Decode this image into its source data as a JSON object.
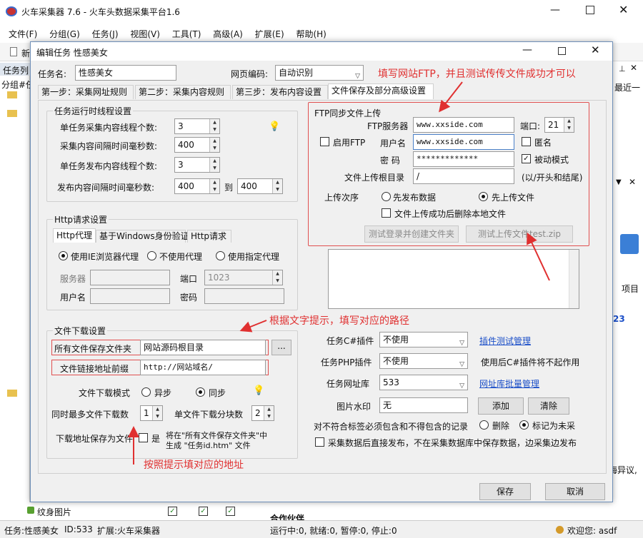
{
  "app": {
    "title": "火车采集器 7.6 - 火车头数据采集平台1.6",
    "menu": [
      "文件(F)",
      "分组(G)",
      "任务(J)",
      "视图(V)",
      "工具(T)",
      "高级(A)",
      "扩展(E)",
      "帮助(H)"
    ],
    "toolbar_new": "新",
    "left_panel_title": "任务列",
    "left_group_label": "分组#任",
    "right_partial_label": "最近一",
    "right_item_label": "项目",
    "right_num": "23",
    "right_text": "海异议,",
    "bottom_tree_label": "纹身图片",
    "bottom_right_text": "合作伙伴"
  },
  "dialog": {
    "title": "编辑任务 性感美女",
    "task_name_label": "任务名:",
    "task_name": "性感美女",
    "encoding_label": "网页编码:",
    "encoding": "自动识别",
    "tabs": [
      "第一步：采集网址规则",
      "第二步：采集内容规则",
      "第三步：发布内容设置",
      "文件保存及部分高级设置"
    ],
    "thread": {
      "title": "任务运行时线程设置",
      "rows": [
        {
          "label": "单任务采集内容线程个数:",
          "value": "3"
        },
        {
          "label": "采集内容间隔时间毫秒数:",
          "value": "400"
        },
        {
          "label": "单任务发布内容线程个数:",
          "value": "3"
        },
        {
          "label": "发布内容间隔时间毫秒数:",
          "value": "400",
          "to_label": "到",
          "to_value": "400"
        }
      ]
    },
    "http": {
      "title": "Http请求设置",
      "tabs": [
        "Http代理",
        "基于Windows身份验证",
        "Http请求"
      ],
      "radios": [
        "使用IE浏览器代理",
        "不使用代理",
        "使用指定代理"
      ],
      "server_label": "服务器",
      "port_label": "端口",
      "port": "1023",
      "user_label": "用户名",
      "pwd_label": "密码"
    },
    "ftp": {
      "title": "FTP同步文件上传",
      "server_label": "FTP服务器",
      "server": "www.xxside.com",
      "port_label": "端口:",
      "port": "21",
      "enable_label": "启用FTP",
      "user_label": "用户名",
      "user": "www.xxside.com",
      "anon_label": "匿名",
      "pwd_label": "密  码",
      "pwd": "*************",
      "passive_label": "被动模式",
      "root_label": "文件上传根目录",
      "root": "/",
      "root_hint": "(以/开头和结尾)",
      "order_label": "上传次序",
      "order_opt1": "先发布数据",
      "order_opt2": "先上传文件",
      "delete_label": "文件上传成功后删除本地文件",
      "btn_login": "测试登录并创建文件夹",
      "btn_upload": "测试上传文件test.zip"
    },
    "download": {
      "title": "文件下载设置",
      "folder_label": "所有文件保存文件夹",
      "folder": "网站源码根目录",
      "browse": "...",
      "prefix_label": "文件链接地址前缀",
      "prefix": "http://网站域名/",
      "mode_label": "文件下载模式",
      "mode_async": "异步",
      "mode_sync": "同步",
      "max_label": "同时最多文件下载数",
      "max": "1",
      "block_label": "单文件下载分块数",
      "block": "2",
      "saveas_label": "下载地址保存为文件",
      "saveas_yes": "是",
      "saveas_desc1": "将在\"所有文件保存文件夹\"中",
      "saveas_desc2": "生成 \"任务id.htm\" 文件"
    },
    "plugins": {
      "cs_label": "任务C#插件",
      "cs_value": "不使用",
      "cs_link": "插件测试管理",
      "php_label": "任务PHP插件",
      "php_value": "不使用",
      "php_note": "使用后C#插件将不起作用",
      "lib_label": "任务网址库",
      "lib_value": "533",
      "lib_link": "网址库批量管理",
      "wm_label": "图片水印",
      "wm_value": "无",
      "add": "添加",
      "clear": "清除",
      "rule_label": "对不符合标签必须包含和不得包含的记录",
      "rule_delete": "删除",
      "rule_mark": "标记为未采",
      "direct_label": "采集数据后直接发布，不在采集数据库中保存数据，边采集边发布"
    },
    "save": "保存",
    "cancel": "取消"
  },
  "annotations": {
    "ftp": "填写网站FTP，并且测试传传文件成功才可以",
    "path": "根据文字提示，填写对应的路径",
    "address": "按照提示填对应的地址"
  },
  "status": {
    "task": "任务:性感美女",
    "id": "ID:533",
    "ext": "扩展:火车采集器",
    "running": "运行中:0, 就绪:0, 暂停:0, 停止:0",
    "welcome": "欢迎您: asdf"
  },
  "colors": {
    "annotation": "#e03030",
    "link": "#1a4ec8",
    "dialog_bg": "#f0f0f0"
  }
}
